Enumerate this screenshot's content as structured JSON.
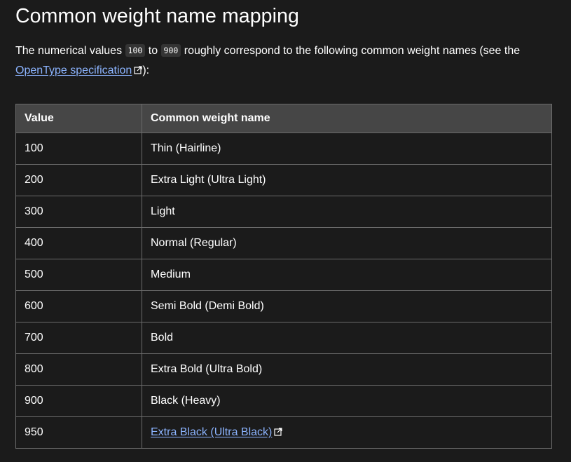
{
  "section": {
    "title": "Common weight name mapping",
    "intro": {
      "text_before": "The numerical values ",
      "code_min": "100",
      "text_mid": " to ",
      "code_max": "900",
      "text_after": " roughly correspond to the following common weight names (see the ",
      "link_label": "OpenType specification",
      "text_end": "):"
    }
  },
  "table": {
    "headers": [
      "Value",
      "Common weight name"
    ],
    "rows": [
      {
        "value": "100",
        "name": "Thin (Hairline)"
      },
      {
        "value": "200",
        "name": "Extra Light (Ultra Light)"
      },
      {
        "value": "300",
        "name": "Light"
      },
      {
        "value": "400",
        "name": "Normal (Regular)"
      },
      {
        "value": "500",
        "name": "Medium"
      },
      {
        "value": "600",
        "name": "Semi Bold (Demi Bold)"
      },
      {
        "value": "700",
        "name": "Bold"
      },
      {
        "value": "800",
        "name": "Extra Bold (Ultra Bold)"
      },
      {
        "value": "900",
        "name": "Black (Heavy)"
      },
      {
        "value": "950",
        "name": "Extra Black (Ultra Black)",
        "is_link": true
      }
    ]
  },
  "icons": {
    "external_link": "external-link-icon"
  },
  "colors": {
    "background": "#1b1b1b",
    "link": "#8cb4ff",
    "header_bg": "#464646",
    "border": "#6b6b6b",
    "code_bg": "#343434"
  }
}
